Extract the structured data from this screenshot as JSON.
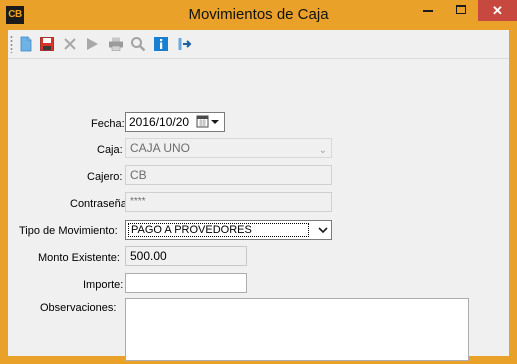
{
  "window": {
    "title": "Movimientos de Caja",
    "app_icon_text": "CB",
    "close_glyph": "✕",
    "accent_color": "#e9a12a",
    "close_color": "#c7483f"
  },
  "toolbar": {
    "buttons": [
      {
        "name": "new-document-icon",
        "enabled": true
      },
      {
        "name": "save-icon",
        "enabled": true
      },
      {
        "name": "delete-icon",
        "enabled": false
      },
      {
        "name": "play-icon",
        "enabled": false
      },
      {
        "name": "print-icon",
        "enabled": false
      },
      {
        "name": "search-icon",
        "enabled": false
      },
      {
        "name": "info-icon",
        "enabled": true
      },
      {
        "name": "exit-icon",
        "enabled": true
      }
    ]
  },
  "form": {
    "fecha_label": "Fecha:",
    "fecha_value": "2016/10/20",
    "caja_label": "Caja:",
    "caja_value": "CAJA UNO",
    "cajero_label": "Cajero:",
    "cajero_value": "CB",
    "contrasena_label": "Contraseña:",
    "contrasena_value": "****",
    "tipo_label": "Tipo de Movimiento:",
    "tipo_value": "PAGO A PROVEDORES",
    "monto_label": "Monto Existente:",
    "monto_value": "500.00",
    "importe_label": "Importe:",
    "importe_value": "",
    "observaciones_label": "Observaciones:",
    "observaciones_value": ""
  }
}
